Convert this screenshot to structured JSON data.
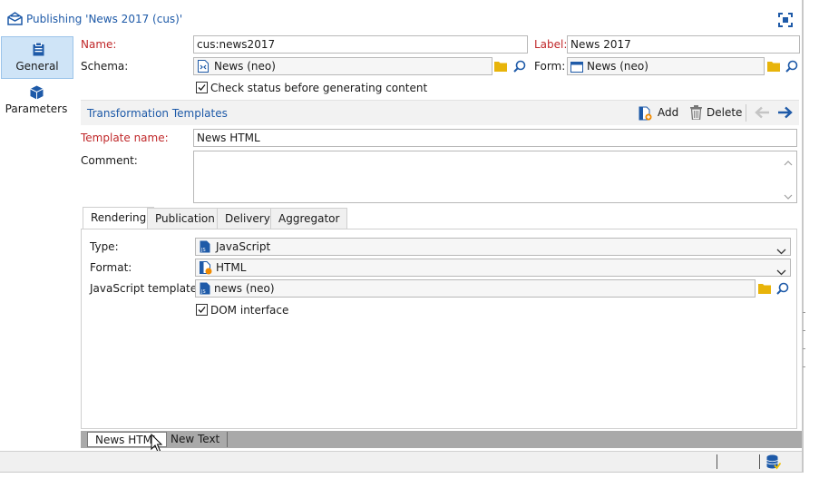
{
  "window": {
    "title": "Publishing 'News 2017 (cus)'"
  },
  "nav": {
    "items": [
      {
        "label": "General",
        "icon": "clipboard-icon",
        "selected": true
      },
      {
        "label": "Parameters",
        "icon": "cube-icon",
        "selected": false
      }
    ]
  },
  "form": {
    "name_label": "Name:",
    "name_value": "cus:news2017",
    "label_label": "Label:",
    "label_value": "News 2017",
    "schema_label": "Schema:",
    "schema_value": "News (neo)",
    "form_label": "Form:",
    "form_value": "News (neo)",
    "check_status_label": "Check status before generating content",
    "check_status_checked": true
  },
  "templates": {
    "section_title": "Transformation Templates",
    "add_label": "Add",
    "delete_label": "Delete",
    "template_name_label": "Template name:",
    "template_name_value": "News HTML",
    "comment_label": "Comment:",
    "comment_value": ""
  },
  "tabs": [
    "Rendering",
    "Publication",
    "Delivery",
    "Aggregator"
  ],
  "rendering": {
    "type_label": "Type:",
    "type_value": "JavaScript",
    "format_label": "Format:",
    "format_value": "HTML",
    "js_templates_label": "JavaScript templates:",
    "js_templates_value": "news (neo)",
    "dom_label": "DOM interface",
    "dom_checked": true
  },
  "bottom_tabs": [
    "News HTML",
    "New Text"
  ],
  "colors": {
    "accent": "#1e5aa8",
    "required": "#c0282a",
    "folder": "#e8b40a",
    "nav_selected": "#cfe4f7"
  }
}
